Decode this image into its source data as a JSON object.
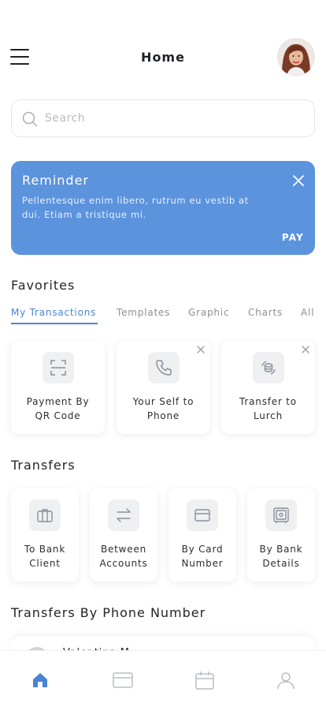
{
  "header": {
    "title": "Home"
  },
  "search": {
    "placeholder": "Search"
  },
  "reminder": {
    "title": "Reminder",
    "text": "Pellentesque enim libero, rutrum eu vestib at dui. Etiam a tristique mi.",
    "action": "PAY"
  },
  "favorites": {
    "title": "Favorites",
    "tabs": [
      "My Transactions",
      "Templates",
      "Graphic",
      "Charts",
      "All"
    ],
    "items": [
      {
        "line1": "Payment By",
        "line2": "QR Code",
        "icon": "qr-scan-icon"
      },
      {
        "line1": "Your Self to",
        "line2": "Phone",
        "icon": "phone-icon"
      },
      {
        "line1": "Transfer to",
        "line2": "Lurch",
        "icon": "coin-transfer-icon"
      }
    ]
  },
  "transfers": {
    "title": "Transfers",
    "items": [
      {
        "line1": "To Bank",
        "line2": "Client",
        "icon": "briefcase-icon"
      },
      {
        "line1": "Between",
        "line2": "Accounts",
        "icon": "swap-arrows-icon"
      },
      {
        "line1": "By Card",
        "line2": "Number",
        "icon": "card-icon"
      },
      {
        "line1": "By Bank",
        "line2": "Details",
        "icon": "safe-icon"
      }
    ]
  },
  "phone_transfers": {
    "title": "Transfers By Phone Number",
    "contact": "Valentina M..."
  },
  "nav": [
    "home-icon",
    "card-icon",
    "calendar-icon",
    "profile-icon"
  ],
  "colors": {
    "accent": "#4a84d2",
    "reminder_bg": "#5b93dd"
  }
}
